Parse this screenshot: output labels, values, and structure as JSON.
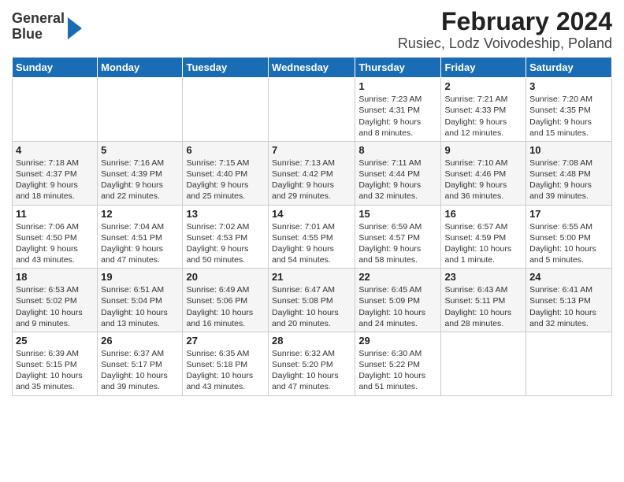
{
  "header": {
    "logo_line1": "General",
    "logo_line2": "Blue",
    "title": "February 2024",
    "subtitle": "Rusiec, Lodz Voivodeship, Poland"
  },
  "weekdays": [
    "Sunday",
    "Monday",
    "Tuesday",
    "Wednesday",
    "Thursday",
    "Friday",
    "Saturday"
  ],
  "weeks": [
    [
      {
        "day": "",
        "info": ""
      },
      {
        "day": "",
        "info": ""
      },
      {
        "day": "",
        "info": ""
      },
      {
        "day": "",
        "info": ""
      },
      {
        "day": "1",
        "info": "Sunrise: 7:23 AM\nSunset: 4:31 PM\nDaylight: 9 hours\nand 8 minutes."
      },
      {
        "day": "2",
        "info": "Sunrise: 7:21 AM\nSunset: 4:33 PM\nDaylight: 9 hours\nand 12 minutes."
      },
      {
        "day": "3",
        "info": "Sunrise: 7:20 AM\nSunset: 4:35 PM\nDaylight: 9 hours\nand 15 minutes."
      }
    ],
    [
      {
        "day": "4",
        "info": "Sunrise: 7:18 AM\nSunset: 4:37 PM\nDaylight: 9 hours\nand 18 minutes."
      },
      {
        "day": "5",
        "info": "Sunrise: 7:16 AM\nSunset: 4:39 PM\nDaylight: 9 hours\nand 22 minutes."
      },
      {
        "day": "6",
        "info": "Sunrise: 7:15 AM\nSunset: 4:40 PM\nDaylight: 9 hours\nand 25 minutes."
      },
      {
        "day": "7",
        "info": "Sunrise: 7:13 AM\nSunset: 4:42 PM\nDaylight: 9 hours\nand 29 minutes."
      },
      {
        "day": "8",
        "info": "Sunrise: 7:11 AM\nSunset: 4:44 PM\nDaylight: 9 hours\nand 32 minutes."
      },
      {
        "day": "9",
        "info": "Sunrise: 7:10 AM\nSunset: 4:46 PM\nDaylight: 9 hours\nand 36 minutes."
      },
      {
        "day": "10",
        "info": "Sunrise: 7:08 AM\nSunset: 4:48 PM\nDaylight: 9 hours\nand 39 minutes."
      }
    ],
    [
      {
        "day": "11",
        "info": "Sunrise: 7:06 AM\nSunset: 4:50 PM\nDaylight: 9 hours\nand 43 minutes."
      },
      {
        "day": "12",
        "info": "Sunrise: 7:04 AM\nSunset: 4:51 PM\nDaylight: 9 hours\nand 47 minutes."
      },
      {
        "day": "13",
        "info": "Sunrise: 7:02 AM\nSunset: 4:53 PM\nDaylight: 9 hours\nand 50 minutes."
      },
      {
        "day": "14",
        "info": "Sunrise: 7:01 AM\nSunset: 4:55 PM\nDaylight: 9 hours\nand 54 minutes."
      },
      {
        "day": "15",
        "info": "Sunrise: 6:59 AM\nSunset: 4:57 PM\nDaylight: 9 hours\nand 58 minutes."
      },
      {
        "day": "16",
        "info": "Sunrise: 6:57 AM\nSunset: 4:59 PM\nDaylight: 10 hours\nand 1 minute."
      },
      {
        "day": "17",
        "info": "Sunrise: 6:55 AM\nSunset: 5:00 PM\nDaylight: 10 hours\nand 5 minutes."
      }
    ],
    [
      {
        "day": "18",
        "info": "Sunrise: 6:53 AM\nSunset: 5:02 PM\nDaylight: 10 hours\nand 9 minutes."
      },
      {
        "day": "19",
        "info": "Sunrise: 6:51 AM\nSunset: 5:04 PM\nDaylight: 10 hours\nand 13 minutes."
      },
      {
        "day": "20",
        "info": "Sunrise: 6:49 AM\nSunset: 5:06 PM\nDaylight: 10 hours\nand 16 minutes."
      },
      {
        "day": "21",
        "info": "Sunrise: 6:47 AM\nSunset: 5:08 PM\nDaylight: 10 hours\nand 20 minutes."
      },
      {
        "day": "22",
        "info": "Sunrise: 6:45 AM\nSunset: 5:09 PM\nDaylight: 10 hours\nand 24 minutes."
      },
      {
        "day": "23",
        "info": "Sunrise: 6:43 AM\nSunset: 5:11 PM\nDaylight: 10 hours\nand 28 minutes."
      },
      {
        "day": "24",
        "info": "Sunrise: 6:41 AM\nSunset: 5:13 PM\nDaylight: 10 hours\nand 32 minutes."
      }
    ],
    [
      {
        "day": "25",
        "info": "Sunrise: 6:39 AM\nSunset: 5:15 PM\nDaylight: 10 hours\nand 35 minutes."
      },
      {
        "day": "26",
        "info": "Sunrise: 6:37 AM\nSunset: 5:17 PM\nDaylight: 10 hours\nand 39 minutes."
      },
      {
        "day": "27",
        "info": "Sunrise: 6:35 AM\nSunset: 5:18 PM\nDaylight: 10 hours\nand 43 minutes."
      },
      {
        "day": "28",
        "info": "Sunrise: 6:32 AM\nSunset: 5:20 PM\nDaylight: 10 hours\nand 47 minutes."
      },
      {
        "day": "29",
        "info": "Sunrise: 6:30 AM\nSunset: 5:22 PM\nDaylight: 10 hours\nand 51 minutes."
      },
      {
        "day": "",
        "info": ""
      },
      {
        "day": "",
        "info": ""
      }
    ]
  ]
}
